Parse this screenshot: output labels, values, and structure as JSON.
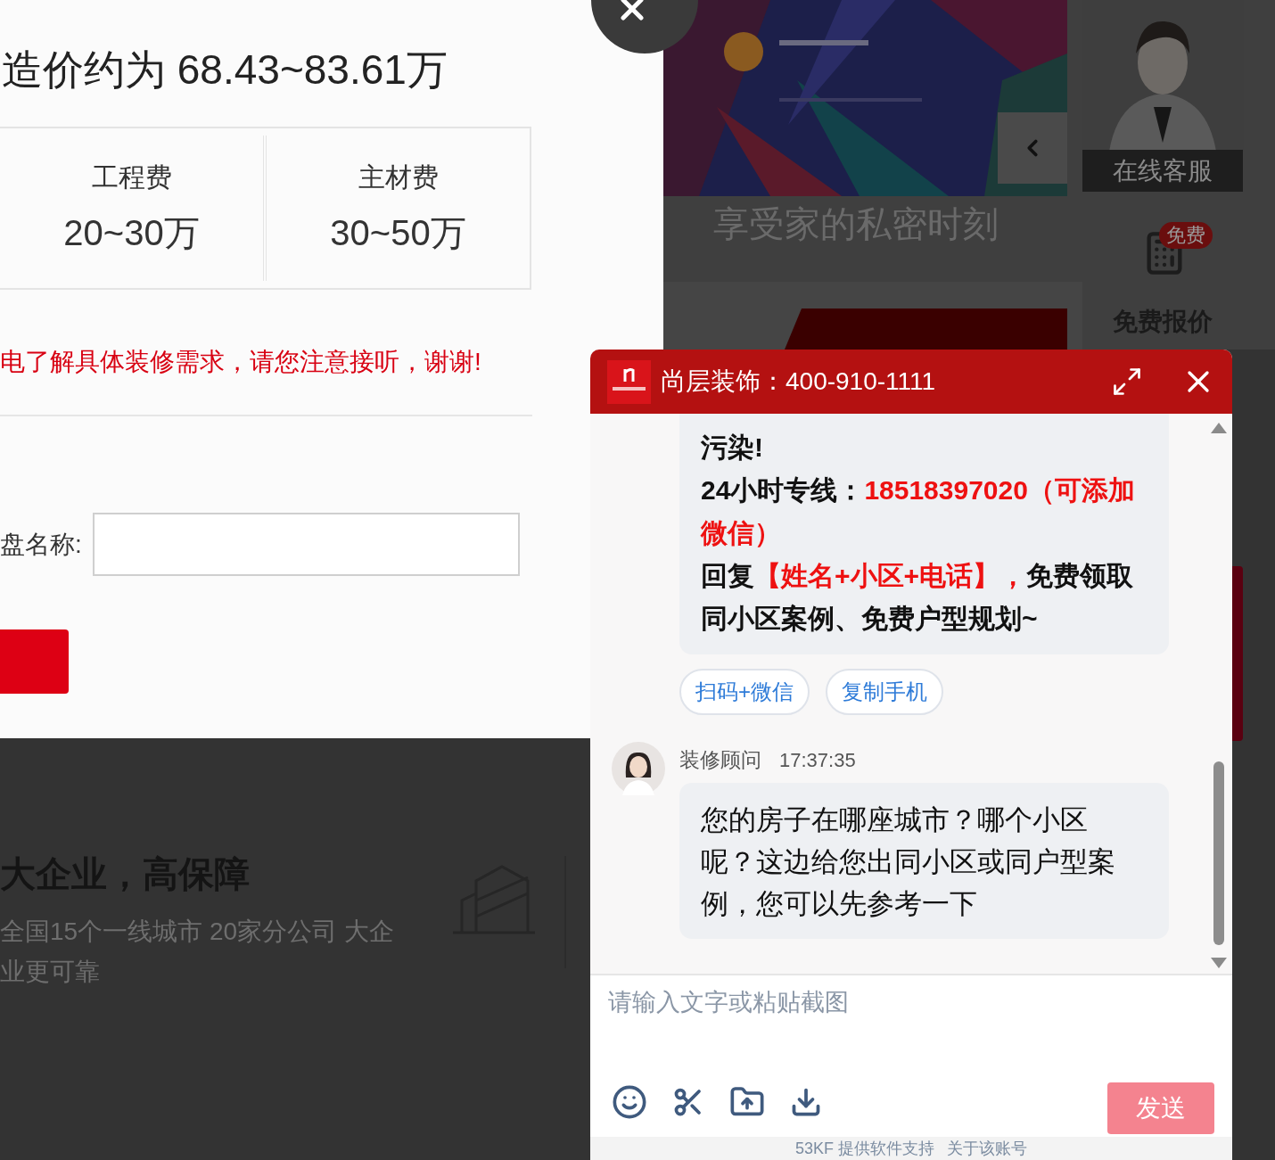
{
  "background": {
    "banner_caption": "享受家的私密时刻",
    "sidebar": {
      "service_label": "在线客服",
      "badge": "免费",
      "quote_label": "免费报价"
    },
    "feature": {
      "title": "大企业，高保障",
      "lines": [
        "全国15个一线城市 20家分公司 大企",
        "业更可靠"
      ]
    }
  },
  "modal": {
    "price_title": "造价约为 68.43~83.61万",
    "fees": [
      {
        "label": "工程费",
        "value": "20~30万"
      },
      {
        "label": "主材费",
        "value": "30~50万"
      }
    ],
    "notice": "电了解具体装修需求，请您注意接听，谢谢!",
    "field_label": "盘名称:"
  },
  "chat": {
    "title": "尚层装饰：400-910-1111",
    "bubble": [
      [
        {
          "text": "污染!",
          "highlight": false
        }
      ],
      [
        {
          "text": "24小时专线：",
          "highlight": false
        },
        {
          "text": "18518397020（可添加微信）",
          "highlight": true
        }
      ],
      [
        {
          "text": "回复",
          "highlight": false
        },
        {
          "text": "【姓名+小区+电话】，",
          "highlight": true
        },
        {
          "text": "免费领取同小区案例、免费户型规划~",
          "highlight": false
        }
      ]
    ],
    "actions": [
      "扫码+微信",
      "复制手机"
    ],
    "agent_message": {
      "sender": "装修顾问",
      "time": "17:37:35",
      "text": "您的房子在哪座城市？哪个小区呢？这边给您出同小区或同户型案例，您可以先参考一下"
    },
    "input": {
      "placeholder": "请输入文字或粘贴截图"
    },
    "send_label": "发送",
    "footer": [
      "53KF 提供软件支持",
      "关于该账号"
    ]
  }
}
